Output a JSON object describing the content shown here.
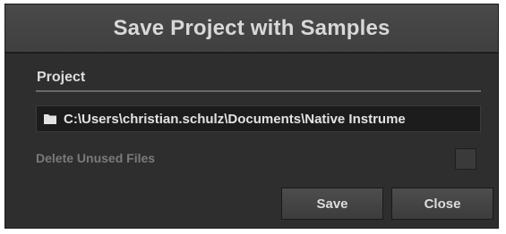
{
  "dialog": {
    "title": "Save Project with Samples",
    "section_label": "Project",
    "path": "C:\\Users\\christian.schulz\\Documents\\Native Instrume",
    "path_icon": "folder-icon",
    "delete_unused_label": "Delete Unused Files",
    "delete_unused_checked": false,
    "buttons": {
      "save": "Save",
      "close": "Close"
    }
  },
  "colors": {
    "background": "#2e2e2e",
    "titlebar": "#454545",
    "field": "#1c1c1c",
    "text": "#dcdcdc",
    "disabled_text": "#7a7a7a"
  }
}
